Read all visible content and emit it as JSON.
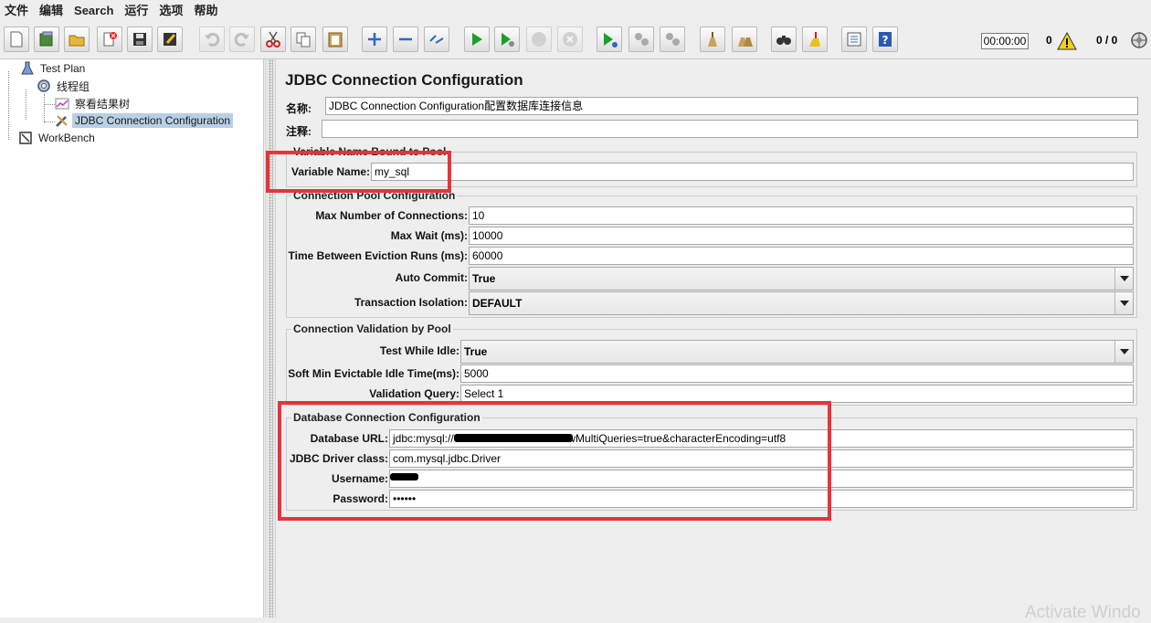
{
  "menu": [
    "文件",
    "编辑",
    "Search",
    "运行",
    "选项",
    "帮助"
  ],
  "toolbar": {
    "timer": "00:00:00",
    "error_count": "0",
    "threads": "0 / 0"
  },
  "tree": {
    "items": [
      {
        "label": "Test Plan"
      },
      {
        "label": "线程组"
      },
      {
        "label": "察看结果树"
      },
      {
        "label": "JDBC Connection Configuration"
      },
      {
        "label": "WorkBench"
      }
    ]
  },
  "panel": {
    "title": "JDBC Connection Configuration",
    "name_label": "名称:",
    "name_value": "JDBC Connection Configuration配置数据库连接信息",
    "comment_label": "注释:",
    "variable_group": "Variable Name Bound to Pool",
    "variable_name_label": "Variable Name:",
    "variable_name_value": "my_sql",
    "pool_group": "Connection Pool Configuration",
    "max_conn_label": "Max Number of Connections:",
    "max_conn_value": "10",
    "max_wait_label": "Max Wait (ms):",
    "max_wait_value": "10000",
    "eviction_label": "Time Between Eviction Runs (ms):",
    "eviction_value": "60000",
    "auto_commit_label": "Auto Commit:",
    "auto_commit_value": "True",
    "isolation_label": "Transaction Isolation:",
    "isolation_value": "DEFAULT",
    "validation_group": "Connection Validation by Pool",
    "test_idle_label": "Test While Idle:",
    "test_idle_value": "True",
    "soft_min_label": "Soft Min Evictable Idle Time(ms):",
    "soft_min_value": "5000",
    "validation_query_label": "Validation Query:",
    "validation_query_value": "Select 1",
    "db_group": "Database Connection Configuration",
    "db_url_label": "Database URL:",
    "db_url_prefix": "jdbc:mysql://",
    "db_url_suffix": "owMultiQueries=true&characterEncoding=utf8",
    "driver_label": "JDBC Driver class:",
    "driver_value": "com.mysql.jdbc.Driver",
    "username_label": "Username:",
    "password_label": "Password:",
    "password_value": "••••••"
  },
  "watermark": "Activate Windo",
  "colors": {
    "highlight": "#e8333b",
    "selection": "#b8cfe5"
  }
}
